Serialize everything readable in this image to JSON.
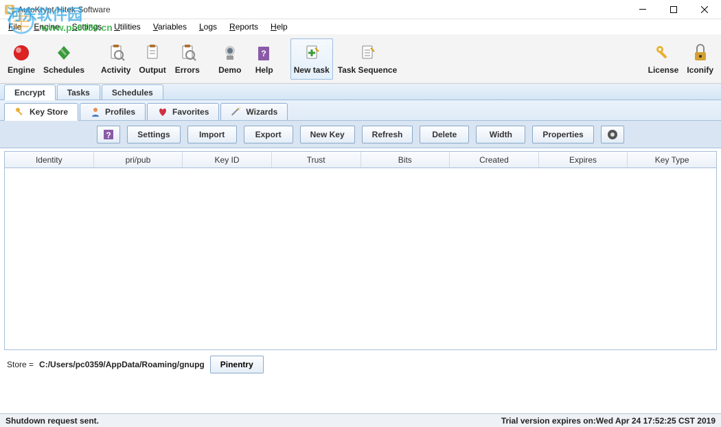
{
  "title": {
    "app": "AutoKrypt",
    "sep": "   - ",
    "vendor": "Hitek Software"
  },
  "menu": {
    "file": "File",
    "engine": "Engine",
    "settings": "Settings",
    "utilities": "Utilities",
    "variables": "Variables",
    "logs": "Logs",
    "reports": "Reports",
    "help": "Help"
  },
  "watermark": {
    "text": "河东软件园",
    "url": "www.pc0359.cn"
  },
  "toolbar": {
    "engine": "Engine",
    "schedules": "Schedules",
    "activity": "Activity",
    "output": "Output",
    "errors": "Errors",
    "demo": "Demo",
    "help": "Help",
    "newtask": "New task",
    "tasksequence": "Task Sequence",
    "license": "License",
    "iconify": "Iconify"
  },
  "main_tabs": {
    "encrypt": "Encrypt",
    "tasks": "Tasks",
    "schedules": "Schedules"
  },
  "sub_tabs": {
    "keystore": "Key Store",
    "profiles": "Profiles",
    "favorites": "Favorites",
    "wizards": "Wizards"
  },
  "actions": {
    "settings": "Settings",
    "import": "Import",
    "export": "Export",
    "newkey": "New Key",
    "refresh": "Refresh",
    "delete": "Delete",
    "width": "Width",
    "properties": "Properties"
  },
  "columns": {
    "identity": "Identity",
    "pripub": "pri/pub",
    "keyid": "Key ID",
    "trust": "Trust",
    "bits": "Bits",
    "created": "Created",
    "expires": "Expires",
    "keytype": "Key Type"
  },
  "store": {
    "label": "Store  = ",
    "path": "C:/Users/pc0359/AppData/Roaming/gnupg",
    "pinentry": "Pinentry"
  },
  "status": {
    "left": "Shutdown request sent.",
    "right_prefix": "Trial version expires on: ",
    "right_value": "Wed Apr 24 17:52:25 CST 2019"
  }
}
